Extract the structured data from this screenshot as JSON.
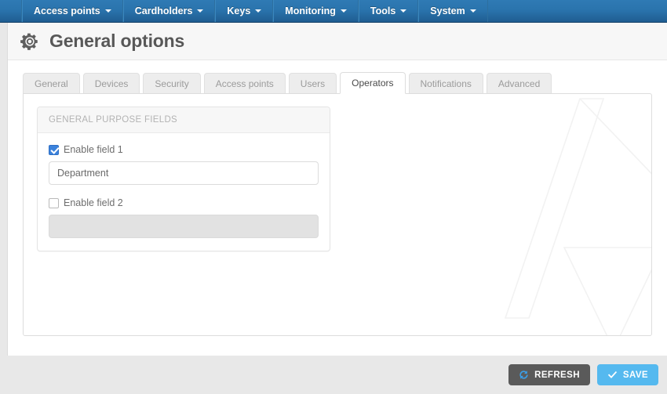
{
  "navbar": {
    "items": [
      {
        "label": "Access points",
        "has_caret": true
      },
      {
        "label": "Cardholders",
        "has_caret": true
      },
      {
        "label": "Keys",
        "has_caret": true
      },
      {
        "label": "Monitoring",
        "has_caret": true
      },
      {
        "label": "Tools",
        "has_caret": true
      },
      {
        "label": "System",
        "has_caret": true
      }
    ]
  },
  "header": {
    "icon": "gear-icon",
    "title": "General options"
  },
  "tabs": [
    {
      "label": "General",
      "active": false
    },
    {
      "label": "Devices",
      "active": false
    },
    {
      "label": "Security",
      "active": false
    },
    {
      "label": "Access points",
      "active": false
    },
    {
      "label": "Users",
      "active": false
    },
    {
      "label": "Operators",
      "active": true
    },
    {
      "label": "Notifications",
      "active": false
    },
    {
      "label": "Advanced",
      "active": false
    }
  ],
  "fieldset": {
    "title": "GENERAL PURPOSE FIELDS",
    "field1": {
      "checkbox_label": "Enable field 1",
      "checked": true,
      "value": "Department",
      "placeholder": "",
      "disabled": false
    },
    "field2": {
      "checkbox_label": "Enable field 2",
      "checked": false,
      "value": "",
      "placeholder": "",
      "disabled": true
    }
  },
  "footer": {
    "refresh_label": "REFRESH",
    "refresh_icon": "refresh-icon",
    "save_label": "SAVE",
    "save_icon": "check-icon"
  },
  "colors": {
    "navbar_top": "#2f7ab4",
    "navbar_bottom": "#1f5d91",
    "accent_blue": "#3b82dc",
    "save_button": "#55b9ef",
    "refresh_button": "#5a5a5a",
    "page_background": "#e8e8e8"
  }
}
